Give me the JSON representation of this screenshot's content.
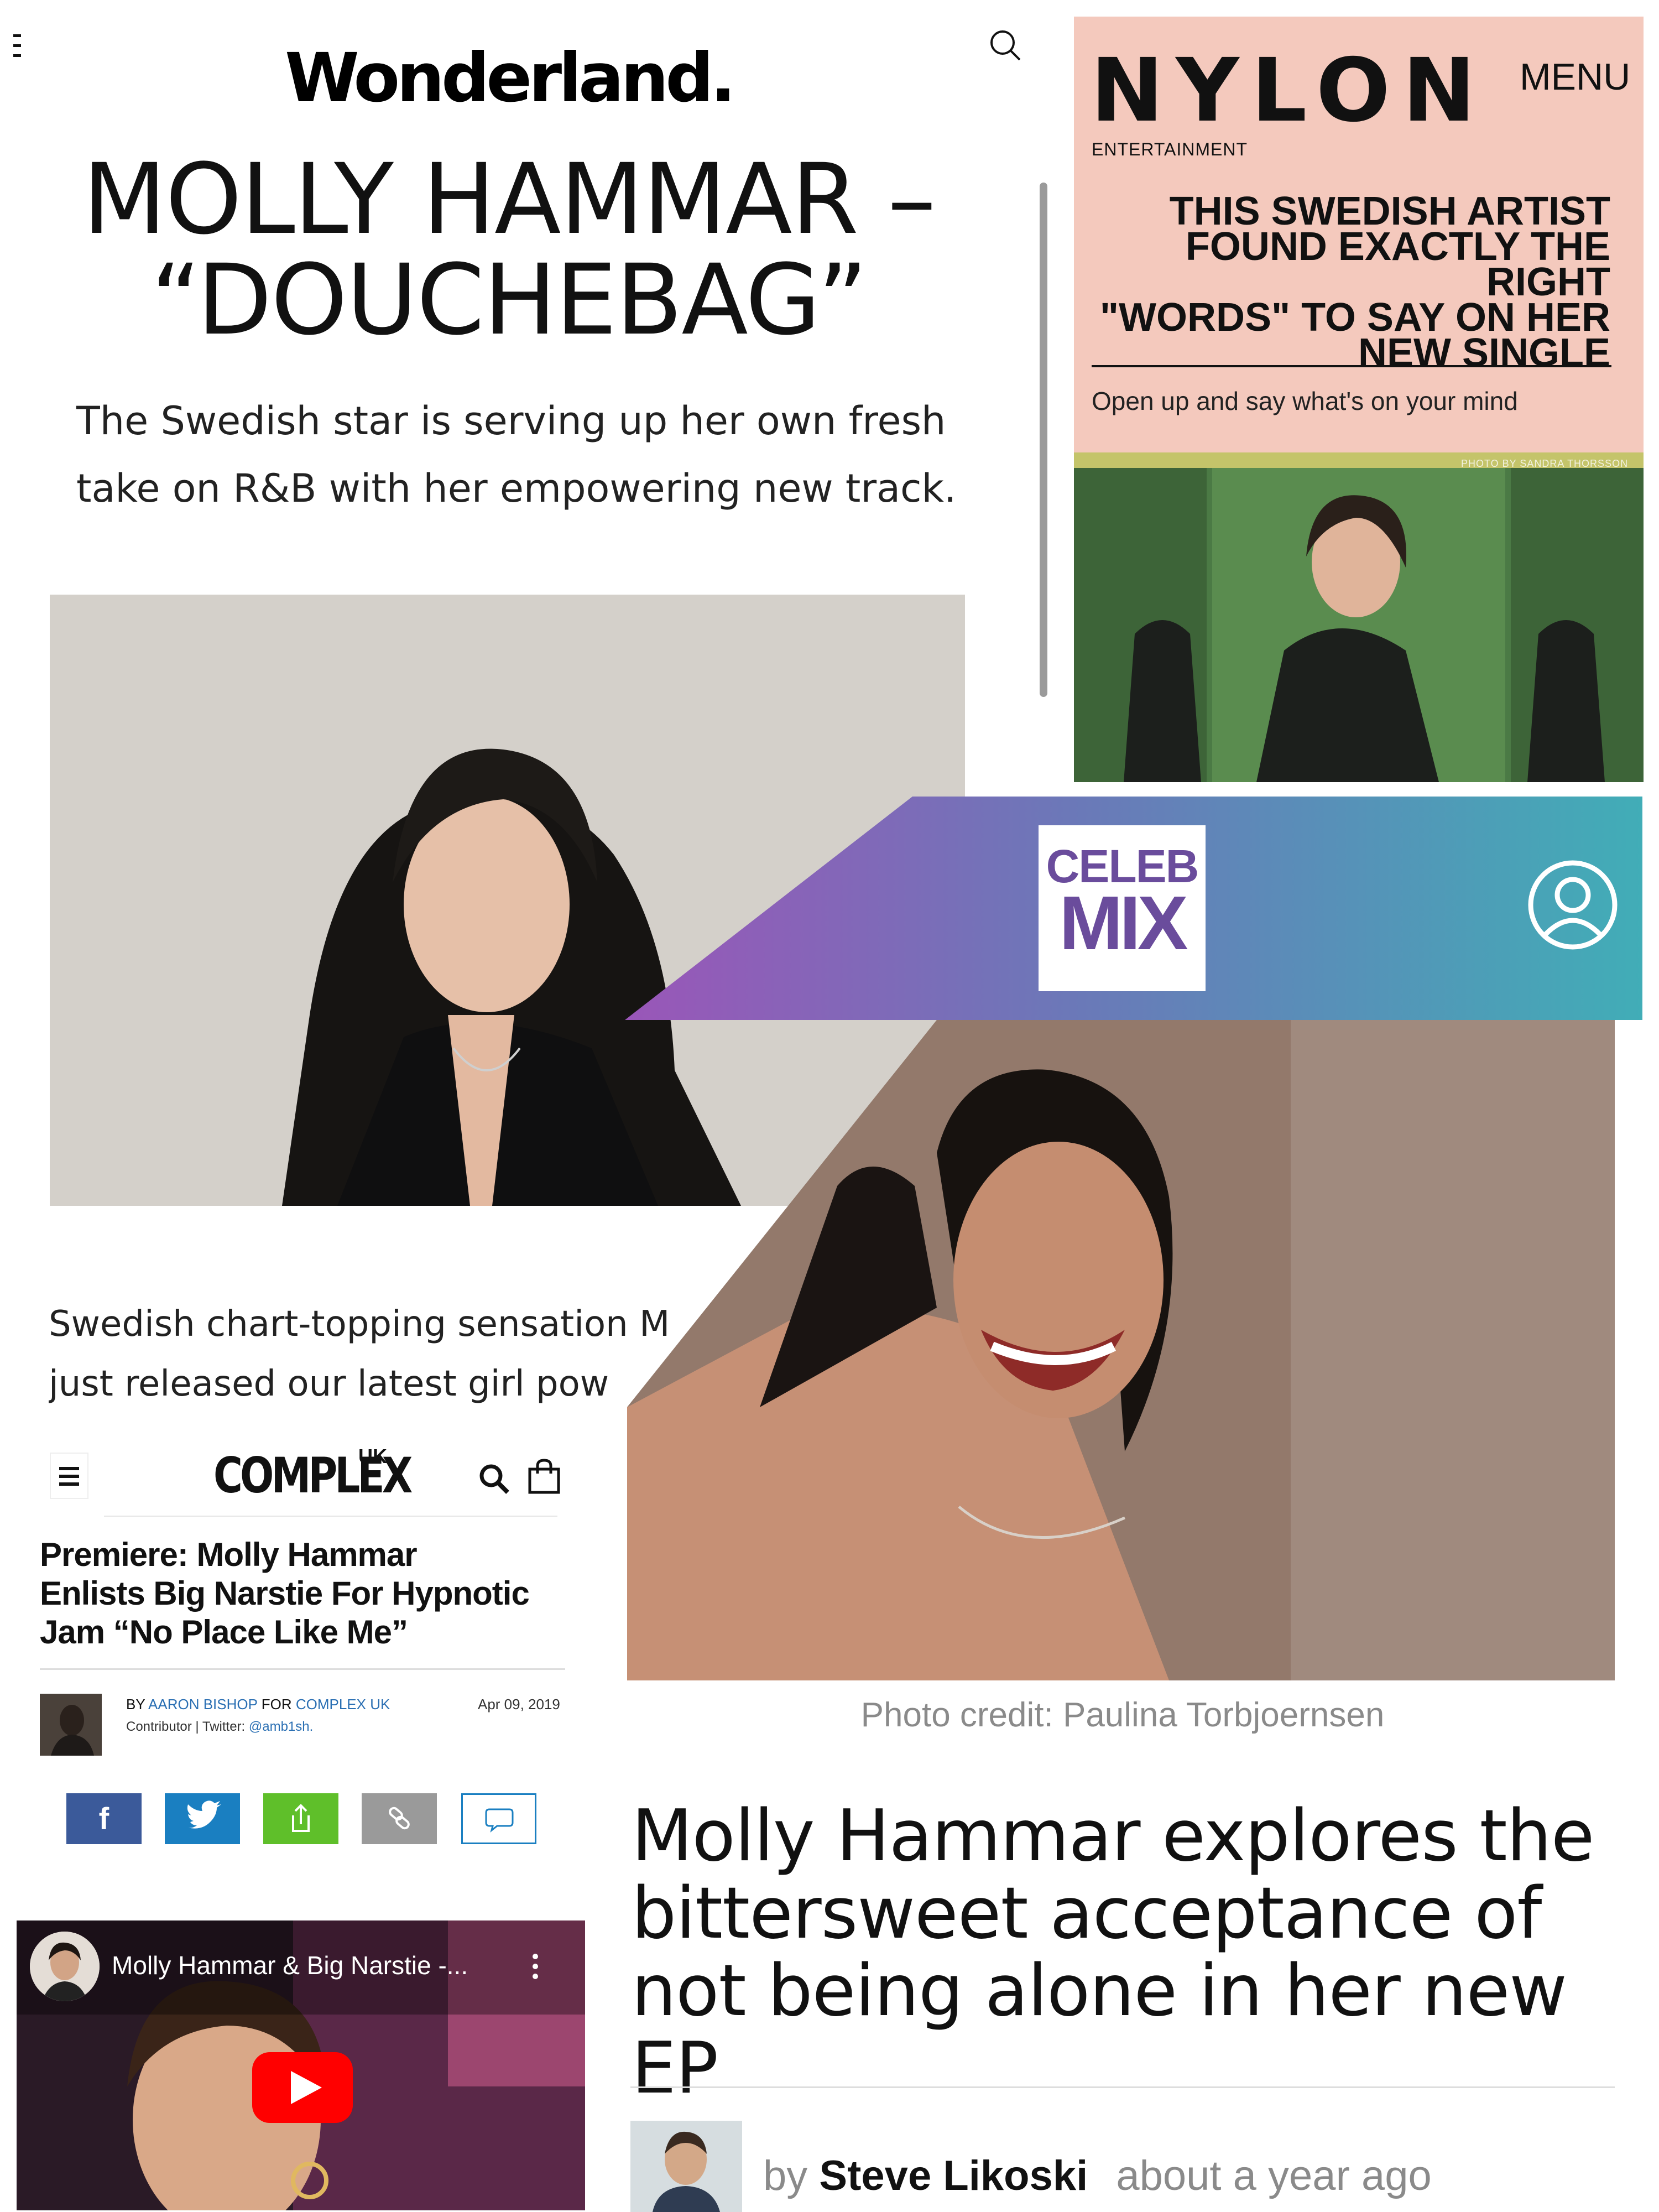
{
  "wonderland": {
    "logo": "Wonderland.",
    "title_line1": "MOLLY HAMMAR –",
    "title_line2": "“DOUCHEBAG”",
    "subtitle_line1": "The Swedish star is serving up her own fresh",
    "subtitle_line2": "take on R&B with her empowering new track.",
    "body_line1": "Swedish chart-topping sensation M",
    "body_line2": "just released our latest girl pow"
  },
  "nylon": {
    "logo": "NYLON",
    "menu_label": "MENU",
    "category": "ENTERTAINMENT",
    "headline_line1": "THIS SWEDISH ARTIST",
    "headline_line2": "FOUND EXACTLY THE RIGHT",
    "headline_line3": "\"WORDS\" TO SAY ON HER",
    "headline_line4": "NEW SINGLE",
    "dek": "Open up and say what's on your mind",
    "photo_credit": "PHOTO BY SANDRA THORSSON"
  },
  "celebmix": {
    "logo_top": "CELEB",
    "logo_bottom": "MIX",
    "photo_credit": "Photo credit: Paulina Torbjoernsen",
    "title_line1": "Molly Hammar explores the",
    "title_line2": "bittersweet acceptance of",
    "title_line3": "not being alone in her new EP",
    "by_prefix": "by",
    "author": "Steve Likoski",
    "time_ago": "about a year ago",
    "colors": {
      "gradient_start": "#9a56b8",
      "gradient_end": "#41adb7",
      "logo": "#6a4c9c"
    }
  },
  "complex": {
    "logo": "COMPLEX",
    "logo_suffix": "UK",
    "headline_line1": "Premiere: Molly Hammar",
    "headline_line2": "Enlists Big Narstie For Hypnotic",
    "headline_line3": "Jam “No Place Like Me”",
    "by_label": "BY",
    "author": "AARON BISHOP",
    "for_label": "FOR",
    "outlet": "COMPLEX UK",
    "role_text": "Contributor | Twitter: ",
    "twitter": "@amb1sh.",
    "date": "Apr 09, 2019",
    "share_buttons": [
      {
        "icon": "facebook-icon",
        "label": "f",
        "color": "#3b5a9a"
      },
      {
        "icon": "twitter-icon",
        "label": "",
        "color": "#1a7fc1"
      },
      {
        "icon": "share-icon",
        "label": "",
        "color": "#5fbf2a"
      },
      {
        "icon": "link-icon",
        "label": "",
        "color": "#9a9a9a"
      },
      {
        "icon": "comment-icon",
        "label": "",
        "color": "#ffffff"
      }
    ],
    "video_title": "Molly Hammar & Big Narstie -..."
  }
}
